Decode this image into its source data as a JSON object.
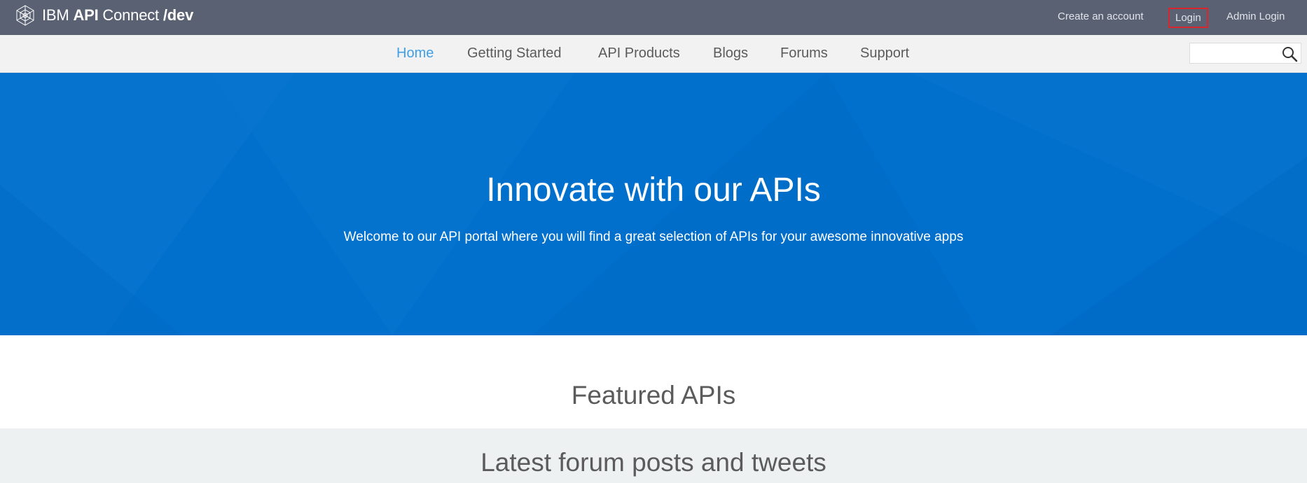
{
  "brand": {
    "logo_icon": "ibm-globe-logo-icon",
    "prefix": "IBM ",
    "product": "API",
    "product_rest": " Connect ",
    "suffix": "/dev"
  },
  "top_links": {
    "create_account": "Create an account",
    "login": "Login",
    "admin_login": "Admin Login"
  },
  "nav": {
    "items": [
      {
        "label": "Home",
        "active": true
      },
      {
        "label": "Getting Started",
        "active": false
      },
      {
        "label": "API Products",
        "active": false
      },
      {
        "label": "Blogs",
        "active": false
      },
      {
        "label": "Forums",
        "active": false
      },
      {
        "label": "Support",
        "active": false
      }
    ],
    "search": {
      "value": "",
      "placeholder": "",
      "icon": "search-icon"
    }
  },
  "hero": {
    "title": "Innovate with our APIs",
    "subtitle": "Welcome to our API portal where you will find a great selection of APIs for your awesome innovative apps"
  },
  "sections": {
    "featured_title": "Featured APIs",
    "latest_title": "Latest forum posts and tweets"
  },
  "colors": {
    "topbar": "#5a6173",
    "navbar": "#f2f2f2",
    "nav_active": "#3fa0e8",
    "hero": "#0070cc",
    "login_highlight": "#d9262e",
    "latest_bg": "#eef1f2"
  }
}
